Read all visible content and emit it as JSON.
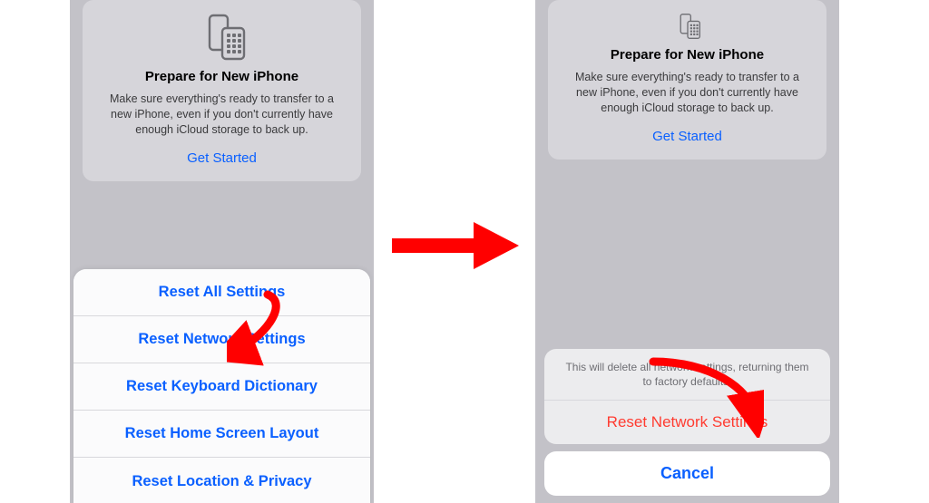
{
  "prepare": {
    "title": "Prepare for New iPhone",
    "desc": "Make sure everything's ready to transfer to a new iPhone, even if you don't currently have enough iCloud storage to back up.",
    "cta": "Get Started"
  },
  "reset_sheet": {
    "items": [
      "Reset All Settings",
      "Reset Network Settings",
      "Reset Keyboard Dictionary",
      "Reset Home Screen Layout",
      "Reset Location & Privacy"
    ]
  },
  "confirm": {
    "message": "This will delete all network settings, returning them to factory defaults.",
    "action": "Reset Network Settings",
    "cancel": "Cancel"
  },
  "colors": {
    "link_blue": "#0a60ff",
    "destructive_red": "#ff3b30",
    "annotation_red": "#ff0000"
  }
}
